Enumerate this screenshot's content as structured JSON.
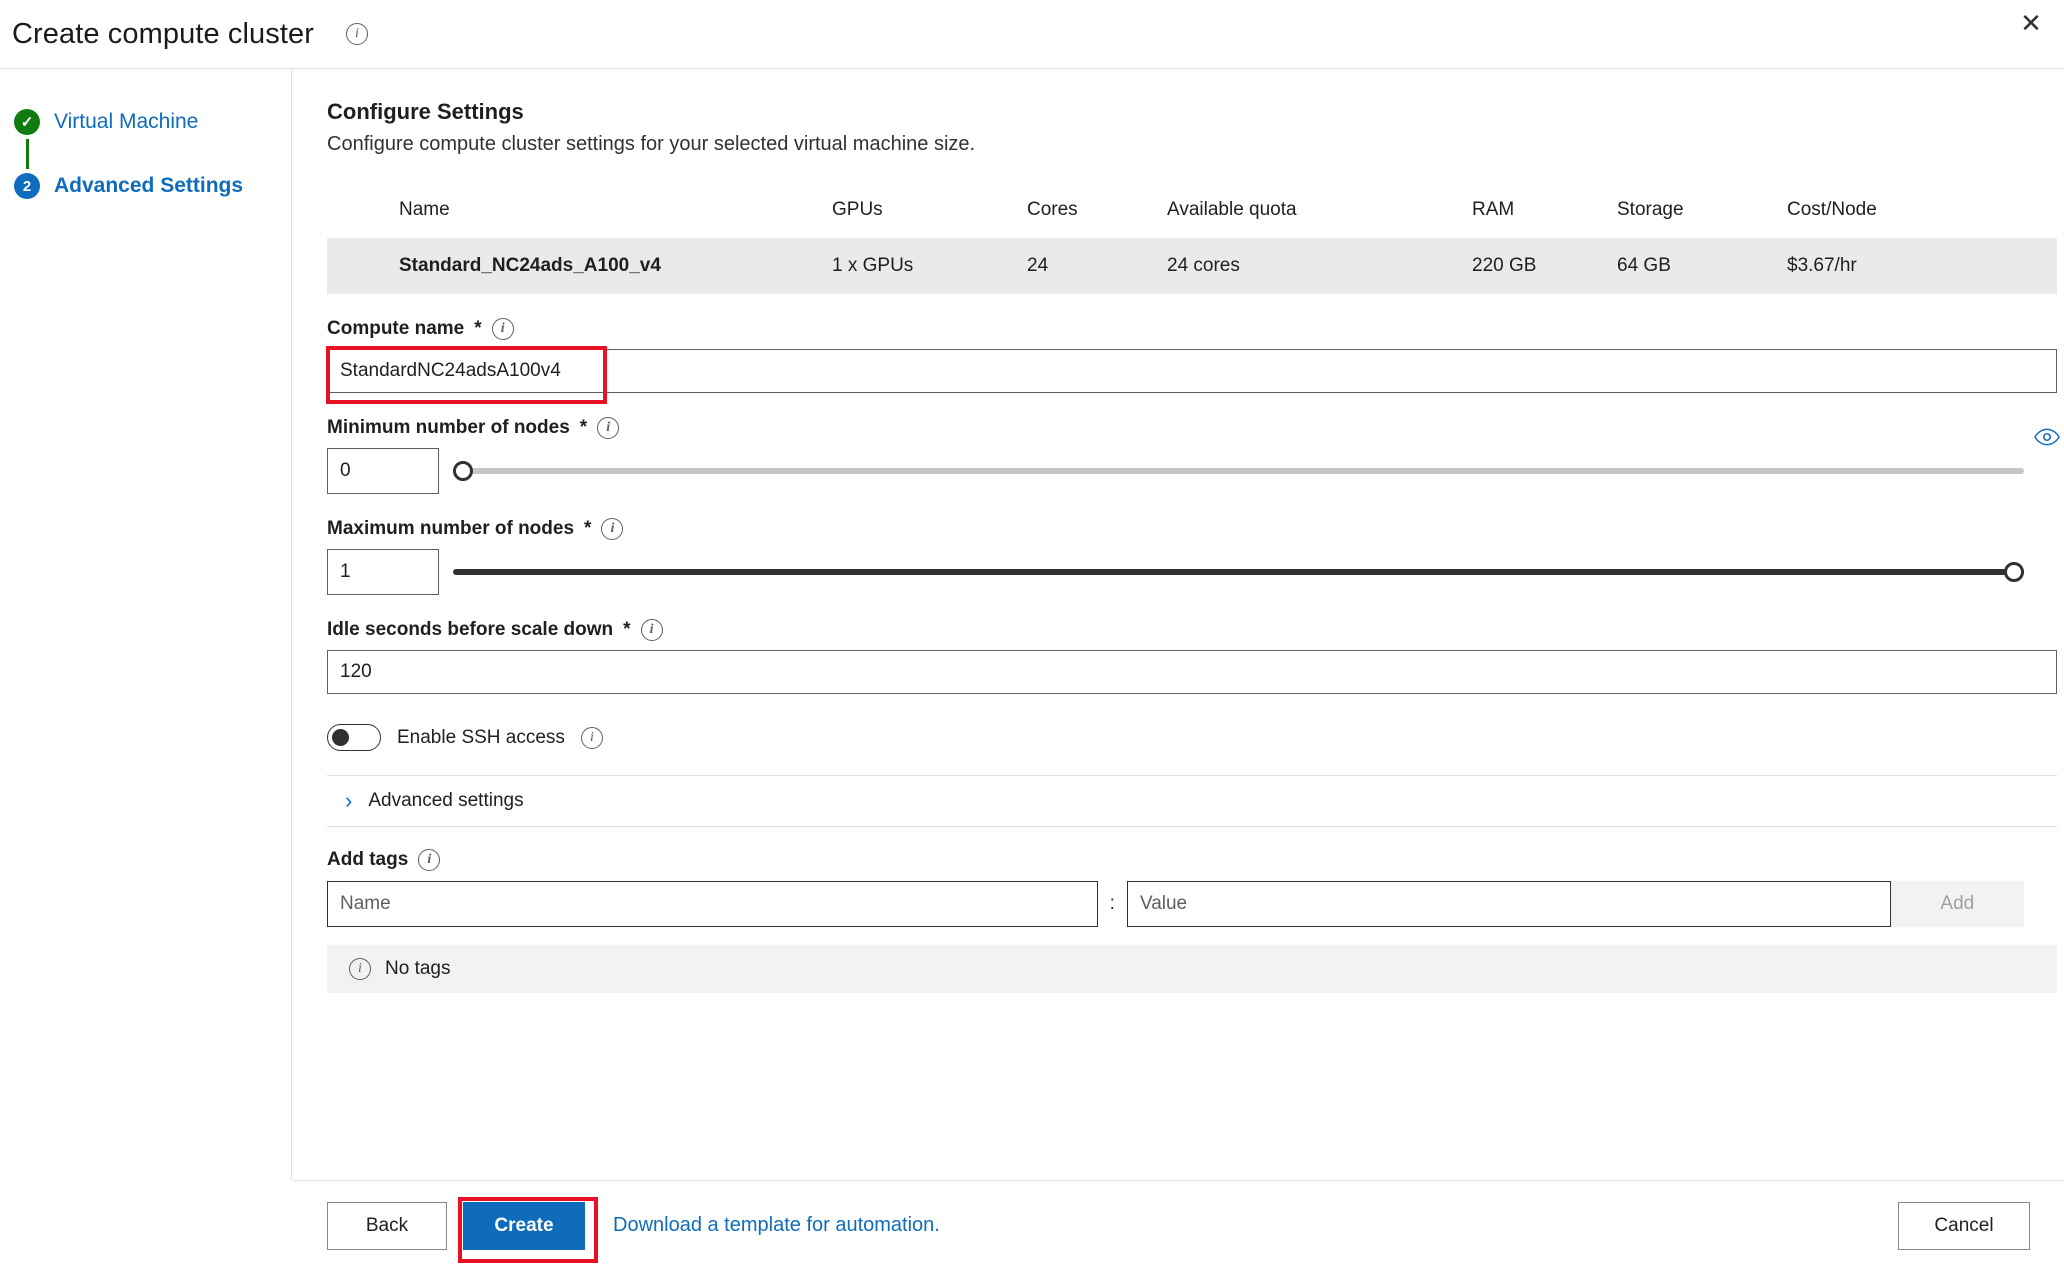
{
  "header": {
    "title": "Create compute cluster",
    "info_icon": "info-icon",
    "close_icon": "close-icon",
    "close_label": "✕"
  },
  "sidebar": {
    "items": [
      {
        "badge": "✓",
        "label": "Virtual Machine",
        "state": "completed"
      },
      {
        "badge": "2",
        "label": "Advanced Settings",
        "state": "active"
      }
    ]
  },
  "main": {
    "section_title": "Configure Settings",
    "section_subtitle": "Configure compute cluster settings for your selected virtual machine size.",
    "table": {
      "columns": [
        "Name",
        "GPUs",
        "Cores",
        "Available quota",
        "RAM",
        "Storage",
        "Cost/Node"
      ],
      "rows": [
        {
          "name": "Standard_NC24ads_A100_v4",
          "gpus": "1 x GPUs",
          "cores": "24",
          "quota": "24 cores",
          "ram": "220 GB",
          "storage": "64 GB",
          "cost": "$3.67/hr"
        }
      ]
    },
    "compute_name": {
      "label": "Compute name",
      "required_mark": "*",
      "value": "StandardNC24adsA100v4",
      "highlight_color": "#e81123"
    },
    "min_nodes": {
      "label": "Minimum number of nodes",
      "required_mark": "*",
      "value": "0",
      "thumb_position": "left",
      "track_style": "grey"
    },
    "max_nodes": {
      "label": "Maximum number of nodes",
      "required_mark": "*",
      "value": "1",
      "thumb_position": "right",
      "track_style": "dark"
    },
    "idle_seconds": {
      "label": "Idle seconds before scale down",
      "required_mark": "*",
      "value": "120"
    },
    "ssh": {
      "label": "Enable SSH access",
      "enabled": "off"
    },
    "advanced": {
      "label": "Advanced settings",
      "chevron": "›",
      "expanded": "false"
    },
    "tags": {
      "label": "Add tags",
      "name_placeholder": "Name",
      "name_value": "",
      "separator": ":",
      "value_placeholder": "Value",
      "value_value": "",
      "add_label": "Add",
      "empty_message": "No tags"
    }
  },
  "footer": {
    "back_label": "Back",
    "create_label": "Create",
    "create_highlight_color": "#e81123",
    "download_link": "Download a template for automation.",
    "cancel_label": "Cancel"
  },
  "colors": {
    "accent_blue": "#0f6cbd",
    "success_green": "#107c10",
    "annotation_red": "#e81123",
    "row_grey": "#eaeaea"
  }
}
